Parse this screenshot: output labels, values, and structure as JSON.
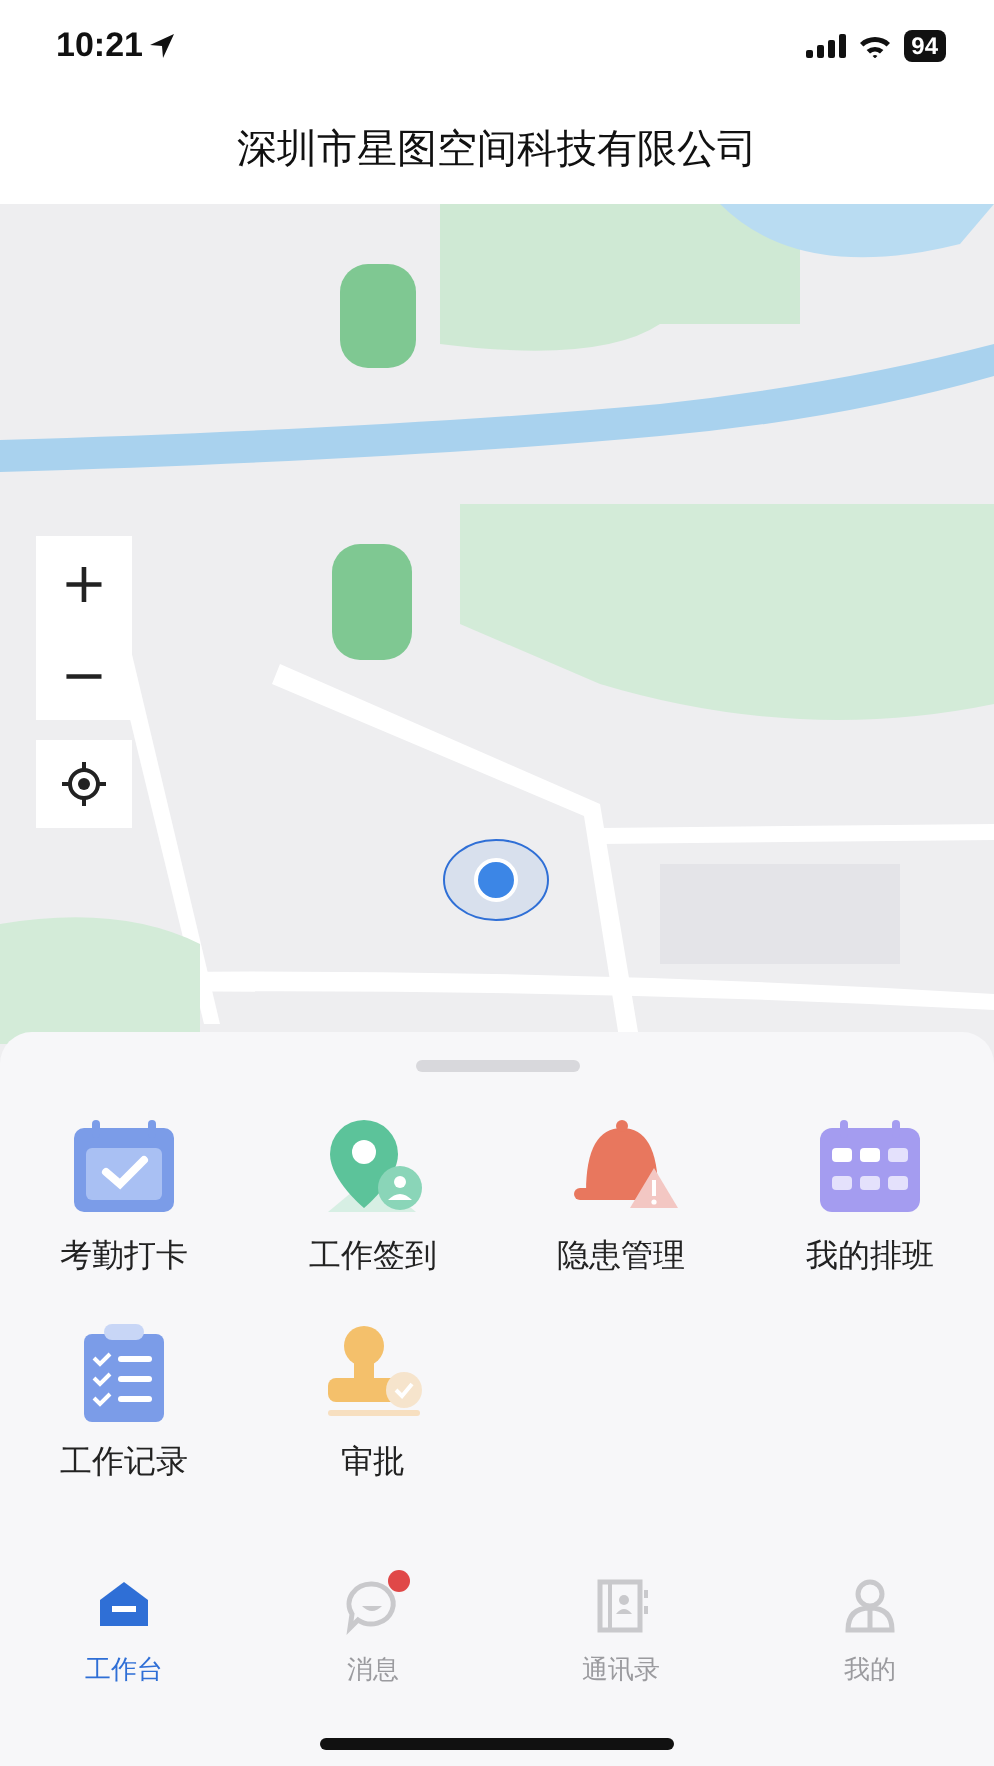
{
  "status_bar": {
    "time": "10:21",
    "battery": "94"
  },
  "header": {
    "title": "深圳市星图空间科技有限公司"
  },
  "map": {
    "kind": "picture",
    "zoom_in": "+",
    "zoom_out": "−"
  },
  "apps": [
    {
      "label": "考勤打卡"
    },
    {
      "label": "工作签到"
    },
    {
      "label": "隐患管理"
    },
    {
      "label": "我的排班"
    },
    {
      "label": "工作记录"
    },
    {
      "label": "审批"
    }
  ],
  "tabs": [
    {
      "label": "工作台",
      "selected": true,
      "badge": false
    },
    {
      "label": "消息",
      "selected": false,
      "badge": true
    },
    {
      "label": "通讯录",
      "selected": false,
      "badge": false
    },
    {
      "label": "我的",
      "selected": false,
      "badge": false
    }
  ]
}
